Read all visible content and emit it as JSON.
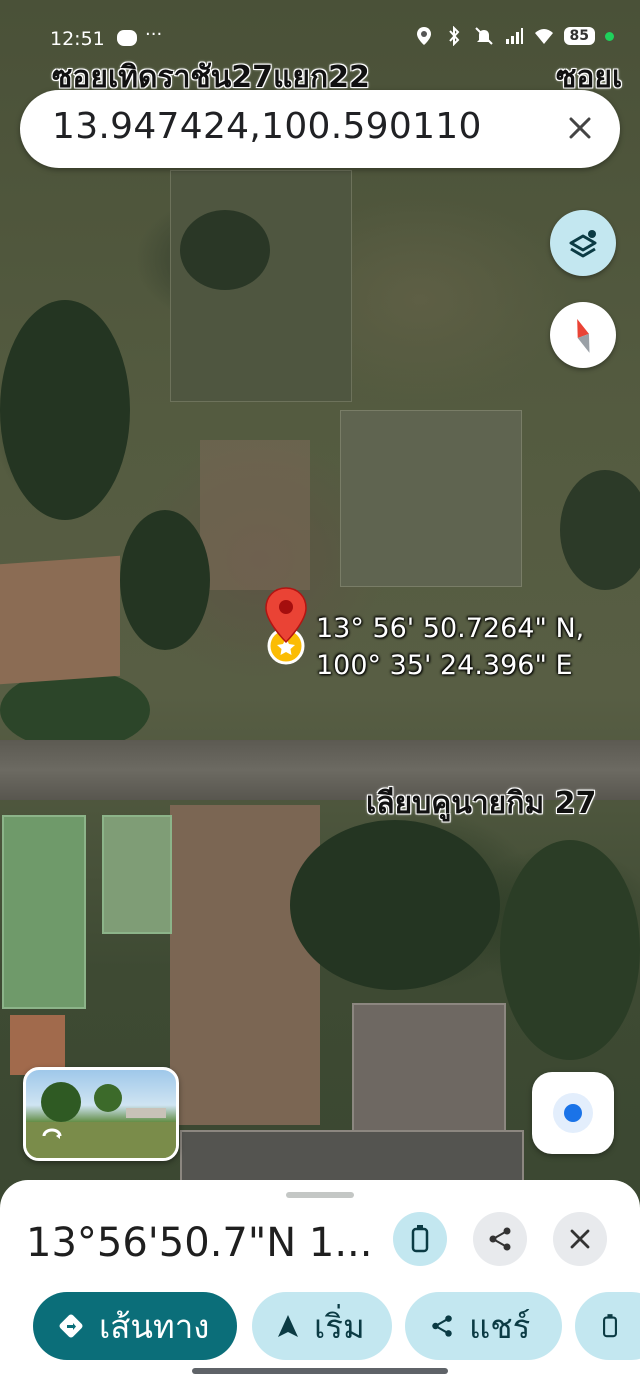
{
  "status_bar": {
    "time": "12:51",
    "dots": "···",
    "battery": "85",
    "icons": [
      "line-app-icon",
      "location-icon",
      "bluetooth-icon",
      "mute-icon",
      "signal-icon",
      "wifi-icon"
    ]
  },
  "search": {
    "query": "13.947424,100.590110"
  },
  "map": {
    "street_top_left": "ซอยเทิดราชัน27แยก22",
    "street_top_right": "ซอยเ",
    "street_middle": "เลียบคูนายกิม 27",
    "pin_coords_line1": "13° 56' 50.7264\" N,",
    "pin_coords_line2": "100° 35' 24.396\" E"
  },
  "sheet": {
    "title": "13°56'50.7\"N 1...",
    "chips": {
      "directions": "เส้นทาง",
      "start": "เริ่ม",
      "share": "แชร์"
    }
  },
  "colors": {
    "accent_teal": "#0b6e79",
    "chip_light": "#c3e7f0",
    "pin_red": "#ea4335"
  }
}
